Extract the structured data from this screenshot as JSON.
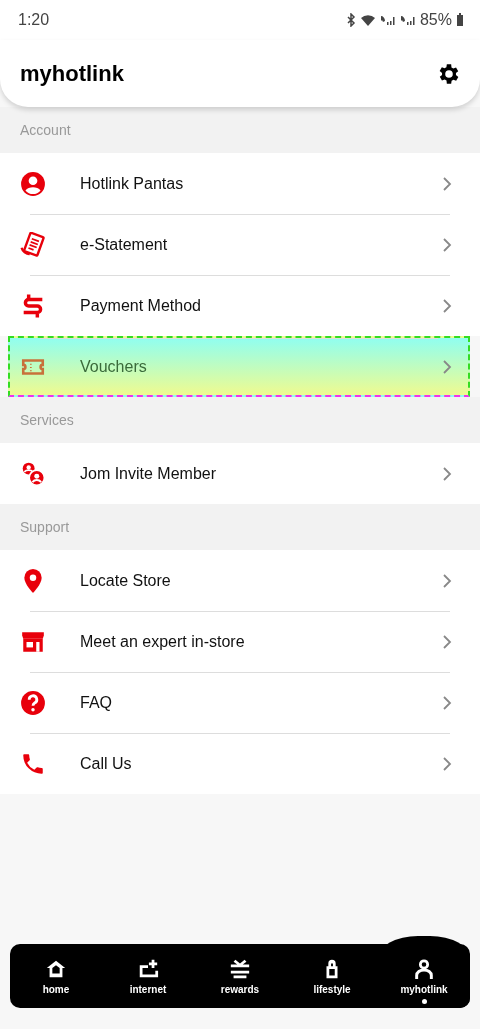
{
  "status_bar": {
    "time": "1:20",
    "battery": "85%"
  },
  "header": {
    "title": "myhotlink"
  },
  "sections": [
    {
      "title": "Account",
      "items": [
        {
          "label": "Hotlink Pantas",
          "highlighted": false
        },
        {
          "label": "e-Statement",
          "highlighted": false
        },
        {
          "label": "Payment Method",
          "highlighted": false
        },
        {
          "label": "Vouchers",
          "highlighted": true
        }
      ]
    },
    {
      "title": "Services",
      "items": [
        {
          "label": "Jom Invite Member",
          "highlighted": false
        }
      ]
    },
    {
      "title": "Support",
      "items": [
        {
          "label": "Locate Store",
          "highlighted": false
        },
        {
          "label": "Meet an expert in-store",
          "highlighted": false
        },
        {
          "label": "FAQ",
          "highlighted": false
        },
        {
          "label": "Call Us",
          "highlighted": false
        }
      ]
    }
  ],
  "nav": [
    {
      "label": "home",
      "selected": false
    },
    {
      "label": "internet",
      "selected": false
    },
    {
      "label": "rewards",
      "selected": false
    },
    {
      "label": "lifestyle",
      "selected": false
    },
    {
      "label": "myhotlink",
      "selected": true
    }
  ]
}
